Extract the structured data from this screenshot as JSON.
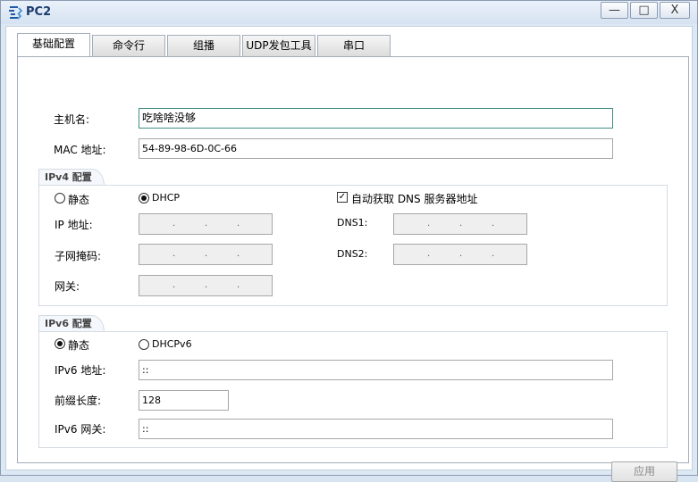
{
  "window": {
    "title": "PC2",
    "minimize_glyph": "—",
    "maximize_glyph": "□",
    "close_glyph": "X"
  },
  "tabs": [
    {
      "label": "基础配置",
      "active": true
    },
    {
      "label": "命令行",
      "active": false
    },
    {
      "label": "组播",
      "active": false
    },
    {
      "label": "UDP发包工具",
      "active": false
    },
    {
      "label": "串口",
      "active": false
    }
  ],
  "basic": {
    "hostname_label": "主机名:",
    "hostname_value": "吃啥啥没够",
    "mac_label": "MAC 地址:",
    "mac_value": "54-89-98-6D-0C-66"
  },
  "ipv4": {
    "section_title": "IPv4 配置",
    "static_label": "静态",
    "static_selected": false,
    "dhcp_label": "DHCP",
    "dhcp_selected": true,
    "auto_dns_label": "自动获取 DNS 服务器地址",
    "auto_dns_checked": true,
    "ip_label": "IP 地址:",
    "mask_label": "子网掩码:",
    "gateway_label": "网关:",
    "dns1_label": "DNS1:",
    "dns2_label": "DNS2:",
    "ip_dot": "."
  },
  "ipv6": {
    "section_title": "IPv6 配置",
    "static_label": "静态",
    "static_selected": true,
    "dhcpv6_label": "DHCPv6",
    "dhcpv6_selected": false,
    "address_label": "IPv6 地址:",
    "address_value": "::",
    "prefix_label": "前缀长度:",
    "prefix_value": "128",
    "gateway_label": "IPv6 网关:",
    "gateway_value": "::"
  },
  "apply_label": "应用",
  "icons": {
    "app": "network-pc-icon",
    "check": "✓"
  }
}
